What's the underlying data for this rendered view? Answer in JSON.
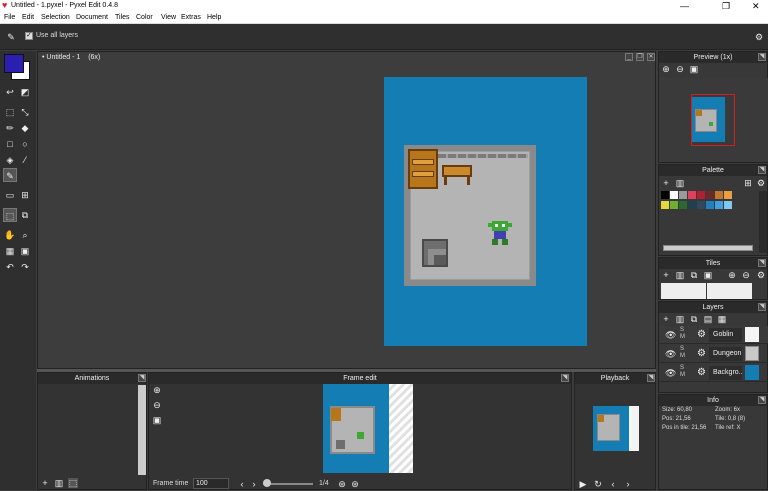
{
  "window": {
    "title": "Untitled - 1.pyxel - Pyxel Edit 0.4.8",
    "minimize": "—",
    "maximize": "❐",
    "close": "✕"
  },
  "menu": [
    "File",
    "Edit",
    "Selection",
    "Document",
    "Tiles",
    "Color",
    "View",
    "Extras",
    "Help"
  ],
  "tool_options": {
    "use_all_layers_label": "Use all layers",
    "use_all_layers_checked": true
  },
  "colors": {
    "primary": "#2a1fb0",
    "secondary": "#ffffff",
    "canvas_bg": "#147db4",
    "accent_red": "#d81e2c"
  },
  "document": {
    "title": "• Untitled - 1",
    "zoom": "(6x)"
  },
  "preview": {
    "title": "Preview (1x)"
  },
  "palette": {
    "title": "Palette",
    "colors": [
      "#000000",
      "#ffffff",
      "#9a9a9a",
      "#e04060",
      "#b02030",
      "#6a2a2a",
      "#c07830",
      "#e8a040",
      "#e8d840",
      "#70b030",
      "#2a6a30",
      "#204050",
      "#304860",
      "#2080c0",
      "#40a0e0",
      "#80c8f0"
    ]
  },
  "tiles": {
    "title": "Tiles"
  },
  "layers": {
    "title": "Layers",
    "items": [
      {
        "name": "Goblin",
        "s": "S",
        "m": "M"
      },
      {
        "name": "Dungeon",
        "s": "S",
        "m": "M"
      },
      {
        "name": "Backgro...",
        "s": "S",
        "m": "M"
      }
    ]
  },
  "info": {
    "title": "Info",
    "size": "Size: 60,80",
    "zoom": "Zoom: 6x",
    "pos": "Pos: 21,56",
    "tile": "Tile: 0,8 (8)",
    "pos_in_tile": "Pos in tile: 21,56",
    "tile_ref": "Tile ref: X"
  },
  "animations": {
    "title": "Animations"
  },
  "frame_edit": {
    "title": "Frame edit",
    "frame_time_label": "Frame time",
    "frame_time_value": "100",
    "frame_counter": "1/4"
  },
  "playback": {
    "title": "Playback"
  }
}
